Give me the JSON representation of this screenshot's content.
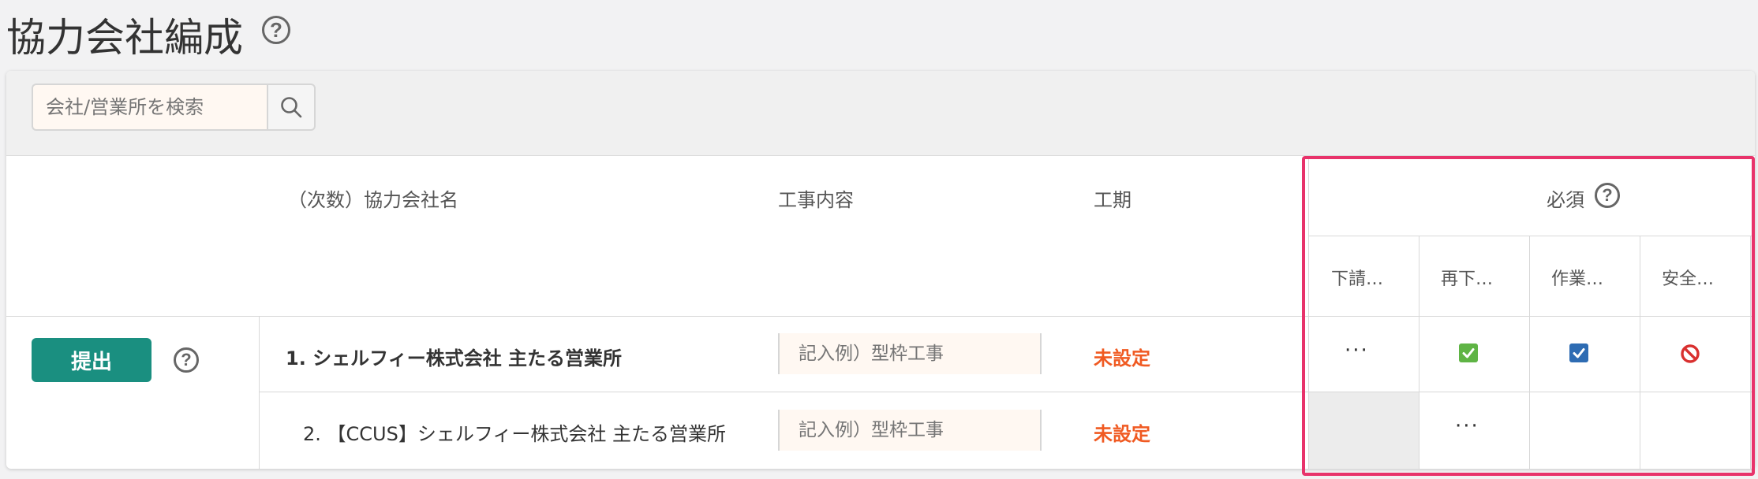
{
  "page": {
    "title": "協力会社編成",
    "help_glyph": "?"
  },
  "search": {
    "placeholder": "会社/営業所を検索",
    "icon": "search-icon"
  },
  "table": {
    "headers": {
      "company": "（次数）協力会社名",
      "work": "工事内容",
      "period": "工期",
      "required": "必須"
    },
    "required_columns": [
      "下請…",
      "再下…",
      "作業…",
      "安全…"
    ],
    "submit_label": "提出",
    "rows": [
      {
        "company": "1. シェルフィー株式会社 主たる営業所",
        "work_placeholder": "記入例）型枠工事",
        "period": "未設定",
        "required": [
          "more",
          "checked-green",
          "checked-blue",
          "prohibited"
        ]
      },
      {
        "company": "2. 【CCUS】シェルフィー株式会社 主たる営業所",
        "work_placeholder": "記入例）型枠工事",
        "period": "未設定",
        "required": [
          "disabled",
          "more",
          "empty",
          "empty"
        ]
      }
    ],
    "more_label": "···"
  },
  "colors": {
    "accent": "#1a8f80",
    "warning": "#f05a22",
    "highlight": "#e8336b",
    "check_green": "#5fb445",
    "check_blue": "#2e6cb3",
    "prohibited": "#d9302f"
  }
}
